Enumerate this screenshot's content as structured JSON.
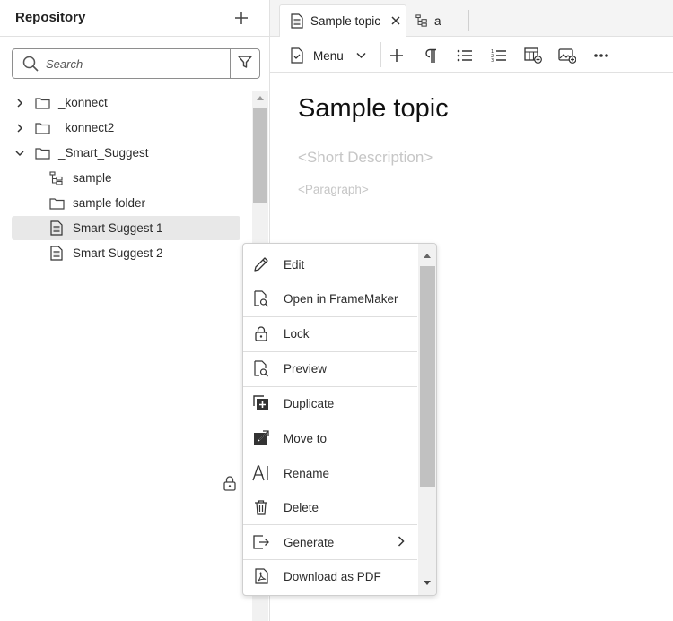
{
  "repository": {
    "title": "Repository",
    "search_placeholder": "Search",
    "tree": [
      {
        "label": "_konnect",
        "type": "folder",
        "expanded": false
      },
      {
        "label": "_konnect2",
        "type": "folder",
        "expanded": false
      },
      {
        "label": "_Smart_Suggest",
        "type": "folder",
        "expanded": true
      },
      {
        "label": "sample",
        "type": "map"
      },
      {
        "label": "sample folder",
        "type": "folder"
      },
      {
        "label": "Smart Suggest 1",
        "type": "topic",
        "selected": true
      },
      {
        "label": "Smart Suggest 2",
        "type": "topic"
      }
    ]
  },
  "editor": {
    "tabs": [
      {
        "label": "Sample topic",
        "active": true,
        "icon": "topic-icon"
      },
      {
        "label": "a",
        "active": false,
        "icon": "map-icon"
      }
    ],
    "toolbar": {
      "menu_label": "Menu",
      "buttons": [
        "plus-icon",
        "paragraph-icon",
        "bulleted-list-icon",
        "numbered-list-icon",
        "insert-table-icon",
        "insert-image-icon",
        "more-icon"
      ]
    },
    "document": {
      "title": "Sample topic",
      "short_description": "<Short Description>",
      "paragraph": "<Paragraph>"
    }
  },
  "context_menu": {
    "items": [
      {
        "label": "Edit",
        "icon": "pencil-icon"
      },
      {
        "label": "Open in FrameMaker",
        "icon": "document-search-icon"
      },
      {
        "label": "Lock",
        "icon": "lock-icon"
      },
      {
        "label": "Preview",
        "icon": "document-search-icon"
      },
      {
        "label": "Duplicate",
        "icon": "duplicate-icon"
      },
      {
        "label": "Move to",
        "icon": "move-icon"
      },
      {
        "label": "Rename",
        "icon": "rename-icon"
      },
      {
        "label": "Delete",
        "icon": "trash-icon"
      },
      {
        "label": "Generate",
        "icon": "export-icon",
        "submenu": true
      },
      {
        "label": "Download as PDF",
        "icon": "pdf-icon"
      }
    ]
  }
}
